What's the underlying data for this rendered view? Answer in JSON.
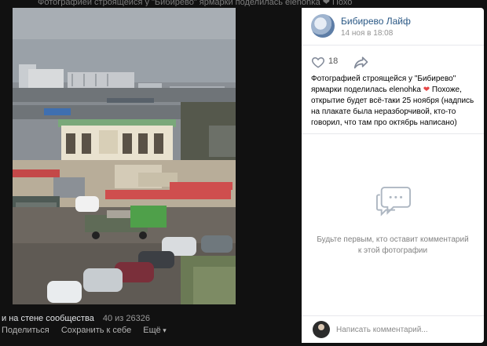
{
  "background": {
    "top_text": "Фотографией строящейся у \"Бибирево\" ярмарки поделилась elenohka ❤ Похоже,"
  },
  "footer": {
    "album_label": "и на стене сообщества",
    "counter": "40 из 26326",
    "actions": [
      "Поделиться",
      "Сохранить к себе",
      "Ещё"
    ]
  },
  "post": {
    "group_name": "Бибирево Лайф",
    "date": "14 ноя в 18:08",
    "likes": "18",
    "caption_before_heart": "Фотографией строящейся у \"Бибирево\" ярмарки поделилась elenohka ",
    "heart": "❤",
    "caption_after_heart": " Похоже, открытие будет всё-таки 25 ноября (надпись на плакате была неразборчивой, кто-то говорил, что там про октябрь написано)"
  },
  "comments": {
    "empty_text": "Будьте первым, кто оставит комментарий к этой фотографии",
    "input_placeholder": "Написать комментарий..."
  },
  "colors": {
    "link": "#2a5885",
    "muted": "#939393",
    "panel_bg": "#ffffff",
    "viewer_bg": "#111111",
    "heart": "#e64646"
  },
  "icons": {
    "like": "heart-outline-icon",
    "share": "share-arrow-icon",
    "empty_comments": "chat-bubble-icon"
  }
}
